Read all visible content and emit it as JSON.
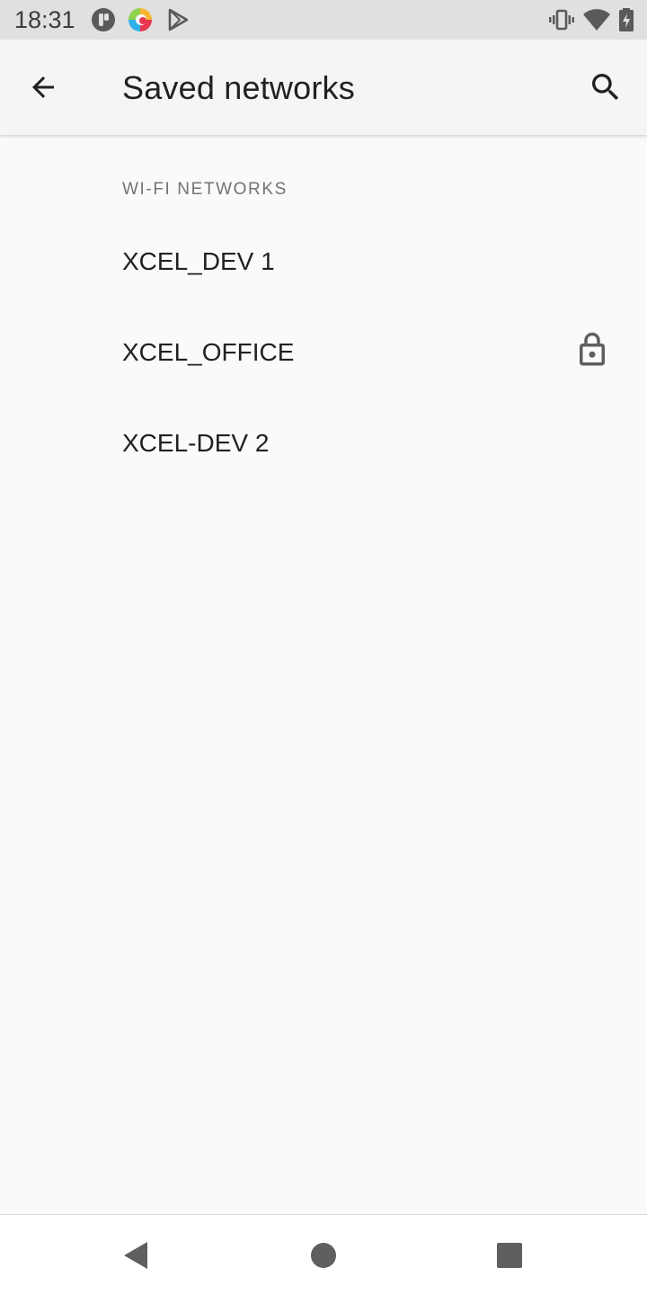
{
  "status_bar": {
    "time": "18:31",
    "left_icons": [
      "notification-app-icon",
      "colorful-app-icon",
      "play-store-icon"
    ],
    "right_icons": [
      "vibrate-icon",
      "wifi-icon",
      "battery-charging-icon"
    ]
  },
  "app_bar": {
    "title": "Saved networks",
    "back_icon": "arrow-back-icon",
    "search_icon": "search-icon"
  },
  "section": {
    "header": "WI-FI NETWORKS"
  },
  "networks": [
    {
      "name": "XCEL_DEV 1",
      "secured": false
    },
    {
      "name": "XCEL_OFFICE",
      "secured": true
    },
    {
      "name": "XCEL-DEV 2",
      "secured": false
    }
  ],
  "nav_bar": {
    "back": "nav-back-icon",
    "home": "nav-home-icon",
    "recents": "nav-recents-icon"
  },
  "colors": {
    "status_bar_bg": "#e0e0e0",
    "app_bar_bg": "#f5f5f5",
    "background": "#fafafa",
    "primary_text": "#212121",
    "secondary_text": "#737373",
    "icon": "#5f5f5f"
  }
}
